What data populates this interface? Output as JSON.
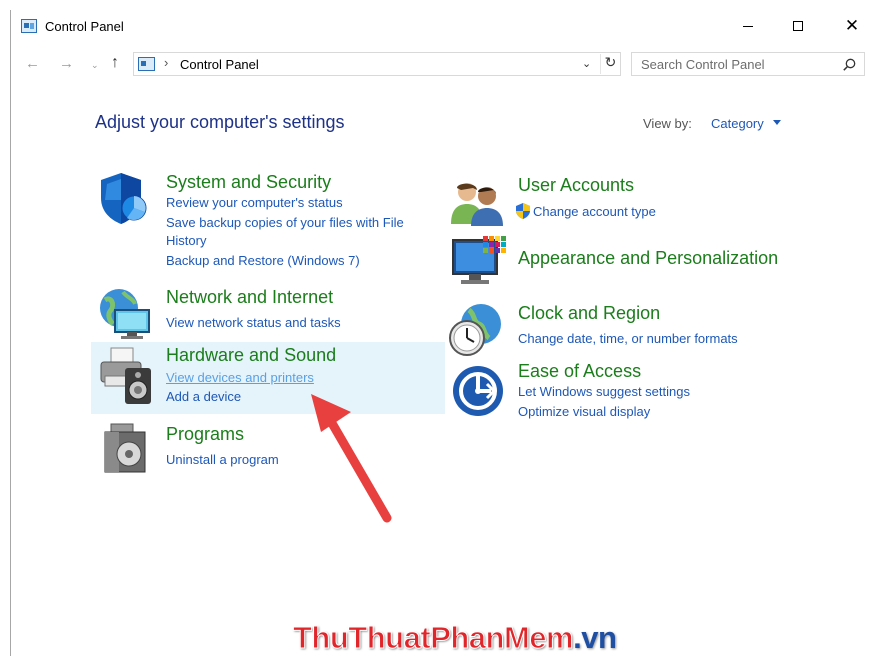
{
  "window": {
    "title": "Control Panel"
  },
  "titlebar": {
    "minimize_label": "—",
    "maximize_label": "□",
    "close_label": "✕"
  },
  "nav": {
    "back": "←",
    "forward": "→",
    "recent": "⌄",
    "up": "↑",
    "breadcrumb_sep": "›",
    "address": "Control Panel",
    "dropdown": "⌄",
    "refresh": "↻",
    "search_placeholder": "Search Control Panel"
  },
  "main": {
    "heading": "Adjust your computer's settings",
    "view_by_label": "View by:",
    "view_by_value": "Category"
  },
  "categories": {
    "system": {
      "title": "System and Security",
      "links": [
        "Review your computer's status",
        "Save backup copies of your files with File",
        "History",
        "Backup and Restore (Windows 7)"
      ]
    },
    "network": {
      "title": "Network and Internet",
      "links": [
        "View network status and tasks"
      ]
    },
    "hardware": {
      "title": "Hardware and Sound",
      "links": [
        "View devices and printers",
        "Add a device"
      ]
    },
    "programs": {
      "title": "Programs",
      "links": [
        "Uninstall a program"
      ]
    },
    "users": {
      "title": "User Accounts",
      "links": [
        "Change account type"
      ]
    },
    "appearance": {
      "title": "Appearance and Personalization",
      "links": []
    },
    "clock": {
      "title": "Clock and Region",
      "links": [
        "Change date, time, or number formats"
      ]
    },
    "ease": {
      "title": "Ease of Access",
      "links": [
        "Let Windows suggest settings",
        "Optimize visual display"
      ]
    }
  },
  "watermark": {
    "part1": "ThuThuat",
    "part2": "PhanMem",
    "part3": ".vn"
  },
  "colors": {
    "heading": "#1e3287",
    "category_title": "#1b7d1b",
    "link": "#1e58b7",
    "hover_background": "#e5f3fb",
    "annotation_arrow": "#e8403f"
  }
}
